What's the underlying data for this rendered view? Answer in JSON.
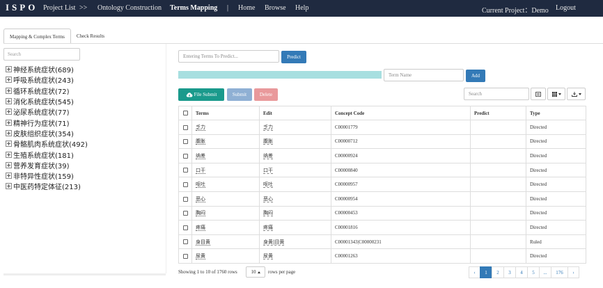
{
  "navbar": {
    "brand": "ISPO",
    "project_list": "Project List",
    "sep1": ">>",
    "ontology": "Ontology Construction",
    "terms_mapping": "Terms Mapping",
    "sep2": "|",
    "home": "Home",
    "browse": "Browse",
    "help": "Help",
    "current_project": "Current Project：Demo",
    "logout": "Logout"
  },
  "tabs": [
    "Mapping & Complex Terms",
    "Check Results"
  ],
  "left": {
    "search_placeholder": "Search",
    "tree": [
      "神经系统症状(689)",
      "呼吸系统症状(243)",
      "循环系统症状(72)",
      "消化系统症状(545)",
      "泌尿系统症状(77)",
      "精神行为症状(71)",
      "皮肤组织症状(354)",
      "骨骼肌肉系统症状(492)",
      "生殖系统症状(181)",
      "营养发育症状(39)",
      "非特异性症状(159)",
      "中医药特定体征(213)"
    ]
  },
  "predict": {
    "placeholder": "Entering Terms To Predict...",
    "button": "Predict"
  },
  "add": {
    "placeholder": "Term Name",
    "button": "Add",
    "progress": 1.0
  },
  "toolbar": {
    "file_submit": "File Submit",
    "submit": "Submit",
    "delete": "Delete",
    "search_placeholder": "Search"
  },
  "table": {
    "headers": [
      "Terms",
      "Edit",
      "Concept Code",
      "Predict",
      "Type"
    ],
    "rows": [
      {
        "term": "乏力",
        "edit": "乏力",
        "code": "C00001779",
        "predict": "",
        "type": "Directed"
      },
      {
        "term": "腹胀",
        "edit": "腹胀",
        "code": "C00000712",
        "predict": "",
        "type": "Directed"
      },
      {
        "term": "纳差",
        "edit": "纳差",
        "code": "C00000924",
        "predict": "",
        "type": "Directed"
      },
      {
        "term": "口干",
        "edit": "口干",
        "code": "C00000840",
        "predict": "",
        "type": "Directed"
      },
      {
        "term": "呕吐",
        "edit": "呕吐",
        "code": "C00000957",
        "predict": "",
        "type": "Directed"
      },
      {
        "term": "恶心",
        "edit": "恶心",
        "code": "C00000954",
        "predict": "",
        "type": "Directed"
      },
      {
        "term": "胸闷",
        "edit": "胸闷",
        "code": "C00000453",
        "predict": "",
        "type": "Directed"
      },
      {
        "term": "疼痛",
        "edit": "疼痛",
        "code": "C00001816",
        "predict": "",
        "type": "Directed"
      },
      {
        "term": "身目黄",
        "edit": "身黄|目黄",
        "code": "C00001343|C00000231",
        "predict": "",
        "type": "Ruled"
      },
      {
        "term": "尿黄",
        "edit": "尿黄",
        "code": "C00001263",
        "predict": "",
        "type": "Directed"
      }
    ]
  },
  "footer": {
    "showing": "Showing 1 to 10 of 1760 rows",
    "per_page_value": "10",
    "per_page_text": "rows per page",
    "pages": [
      "‹",
      "1",
      "2",
      "3",
      "4",
      "5",
      "...",
      "176",
      "›"
    ]
  },
  "colors": {
    "navbar": "#1f2a40",
    "primary": "#337ab7",
    "teal": "#1a9a8c",
    "submit_disabled": "#8fb0d4",
    "delete_disabled": "#e9999b",
    "progress": "#a7dfe0"
  }
}
